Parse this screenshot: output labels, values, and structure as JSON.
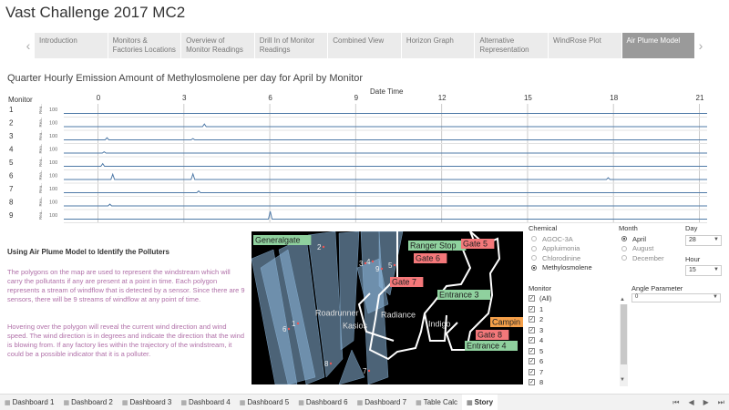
{
  "title": "Vast Challenge 2017 MC2",
  "story_points": [
    {
      "label": "Introduction",
      "active": false
    },
    {
      "label": "Monitors & Factories Locations",
      "active": false
    },
    {
      "label": "Overview of Monitor Readings",
      "active": false
    },
    {
      "label": "Drill In of Monitor Readings",
      "active": false
    },
    {
      "label": "Combined View",
      "active": false
    },
    {
      "label": "Horizon Graph",
      "active": false
    },
    {
      "label": "Alternative Representation",
      "active": false
    },
    {
      "label": "WindRose Plot",
      "active": false
    },
    {
      "label": "Air Plume Model",
      "active": true
    }
  ],
  "nav_prev": "‹",
  "nav_next": "›",
  "chart_title": "Quarter Hourly Emission Amount of Methylosmolene per day for April by Monitor",
  "horizon": {
    "row_header": "Monitor",
    "column_header": "Date Time",
    "hours": [
      "0",
      "3",
      "6",
      "9",
      "12",
      "15",
      "18",
      "21"
    ],
    "monitors": [
      "1",
      "2",
      "3",
      "4",
      "5",
      "6",
      "7",
      "8",
      "9"
    ],
    "axis_label": "Rea..",
    "tick": "100",
    "series_color": "#4e79a7",
    "spikes": [
      [],
      [
        {
          "h": 3.7,
          "v": 0.3
        }
      ],
      [
        {
          "h": 0.3,
          "v": 0.25
        },
        {
          "h": 3.3,
          "v": 0.15
        }
      ],
      [
        {
          "h": 0.2,
          "v": 0.15
        }
      ],
      [
        {
          "h": 0.15,
          "v": 0.3
        }
      ],
      [
        {
          "h": 0.5,
          "v": 0.6
        },
        {
          "h": 3.3,
          "v": 0.65
        },
        {
          "h": 17.8,
          "v": 0.2
        }
      ],
      [
        {
          "h": 3.5,
          "v": 0.2
        }
      ],
      [
        {
          "h": 0.4,
          "v": 0.2
        }
      ],
      [
        {
          "h": 6.0,
          "v": 0.9
        }
      ]
    ]
  },
  "story": {
    "heading": "Using Air Plume Model to Identify the Polluters",
    "p1": "The polygons on the map are used to represent the windstream which will carry the pollutants if any are present at a point in time. Each polygon represents a stream of windflow that is detected by a sensor. Since there are 9 sensors, there will be 9 streams of windflow at any point of time.",
    "p2": "Hovering over the polygon will reveal the current wind direction and wind speed. The wind direction is in degrees and indicate the direction that the wind is blowing from. If any factory lies within the trajectory of the windstream, it could be a possible indicator that it is a polluter."
  },
  "map": {
    "labels": [
      {
        "text": "Generalgate",
        "style": "green"
      },
      {
        "text": "Ranger Stop",
        "style": "green"
      },
      {
        "text": "Gate 5",
        "style": "red"
      },
      {
        "text": "Gate 6",
        "style": "red"
      },
      {
        "text": "Gate 7",
        "style": "red"
      },
      {
        "text": "Entrance 3",
        "style": "green"
      },
      {
        "text": "Roadrunner",
        "style": "plain"
      },
      {
        "text": "Kasios",
        "style": "plain"
      },
      {
        "text": "Radiance",
        "style": "plain"
      },
      {
        "text": "Indigo",
        "style": "plain"
      },
      {
        "text": "Campin",
        "style": "orange"
      },
      {
        "text": "Gate 8",
        "style": "red"
      },
      {
        "text": "Entrance 4",
        "style": "green"
      }
    ],
    "stream_numbers": [
      "1",
      "2",
      "3",
      "4",
      "5",
      "6",
      "7",
      "8",
      "9"
    ],
    "colors": {
      "green": "#8fd19e",
      "red": "#f4787a",
      "orange": "#f5a04a",
      "stream": "#8ab4d8"
    }
  },
  "filters": {
    "chemical": {
      "title": "Chemical",
      "options": [
        "AGOC-3A",
        "Appluimonia",
        "Chlorodinine",
        "Methylosmolene"
      ],
      "selected": "Methylosmolene"
    },
    "month": {
      "title": "Month",
      "options": [
        "April",
        "August",
        "December"
      ],
      "selected": "April"
    },
    "day": {
      "title": "Day",
      "value": "28"
    },
    "hour": {
      "title": "Hour",
      "value": "15"
    },
    "monitor": {
      "title": "Monitor",
      "options": [
        "(All)",
        "1",
        "2",
        "3",
        "4",
        "5",
        "6",
        "7",
        "8"
      ]
    },
    "angle": {
      "title": "Angle Parameter",
      "value": "0"
    }
  },
  "tabs": [
    {
      "label": "Dashboard 1",
      "active": false
    },
    {
      "label": "Dashboard 2",
      "active": false
    },
    {
      "label": "Dashboard 3",
      "active": false
    },
    {
      "label": "Dashboard 4",
      "active": false
    },
    {
      "label": "Dashboard 5",
      "active": false
    },
    {
      "label": "Dashboard 6",
      "active": false
    },
    {
      "label": "Dashboard 7",
      "active": false
    },
    {
      "label": "Table Calc",
      "active": false
    },
    {
      "label": "Story",
      "active": true
    }
  ]
}
